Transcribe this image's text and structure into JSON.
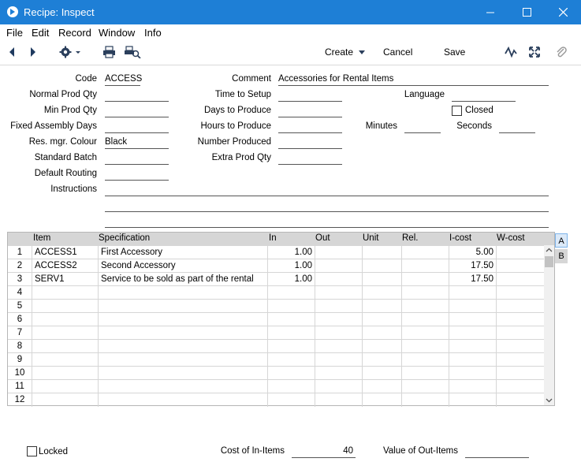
{
  "window": {
    "title": "Recipe: Inspect"
  },
  "menu": [
    "File",
    "Edit",
    "Record",
    "Window",
    "Info"
  ],
  "toolbar": {
    "create_label": "Create",
    "cancel_label": "Cancel",
    "save_label": "Save"
  },
  "header": {
    "code_label": "Code",
    "code_value": "ACCESS",
    "comment_label": "Comment",
    "comment_value": "Accessories for Rental Items",
    "normal_prod_qty_label": "Normal Prod Qty",
    "normal_prod_qty_value": "",
    "time_to_setup_label": "Time to Setup",
    "time_to_setup_value": "",
    "language_label": "Language",
    "language_value": "",
    "min_prod_qty_label": "Min Prod Qty",
    "min_prod_qty_value": "",
    "days_to_produce_label": "Days to Produce",
    "days_to_produce_value": "",
    "closed_label": "Closed",
    "closed_checked": false,
    "fixed_assembly_days_label": "Fixed Assembly Days",
    "fixed_assembly_days_value": "",
    "hours_to_produce_label": "Hours to Produce",
    "hours_to_produce_value": "",
    "minutes_label": "Minutes",
    "minutes_value": "",
    "seconds_label": "Seconds",
    "seconds_value": "",
    "res_mgr_colour_label": "Res. mgr. Colour",
    "res_mgr_colour_value": "Black",
    "number_produced_label": "Number Produced",
    "number_produced_value": "",
    "standard_batch_label": "Standard Batch",
    "standard_batch_value": "",
    "extra_prod_qty_label": "Extra Prod Qty",
    "extra_prod_qty_value": "",
    "default_routing_label": "Default Routing",
    "default_routing_value": "",
    "instructions_label": "Instructions",
    "instructions_value": ""
  },
  "grid": {
    "columns": [
      "Item",
      "Specification",
      "In",
      "Out",
      "Unit",
      "Rel.",
      "I-cost",
      "W-cost"
    ],
    "rows": [
      {
        "n": "1",
        "item": "ACCESS1",
        "spec": "First Accessory",
        "in": "1.00",
        "out": "",
        "unit": "",
        "rel": "",
        "icost": "5.00",
        "wcost": ""
      },
      {
        "n": "2",
        "item": "ACCESS2",
        "spec": "Second Accessory",
        "in": "1.00",
        "out": "",
        "unit": "",
        "rel": "",
        "icost": "17.50",
        "wcost": ""
      },
      {
        "n": "3",
        "item": "SERV1",
        "spec": "Service to be sold as part of the rental",
        "in": "1.00",
        "out": "",
        "unit": "",
        "rel": "",
        "icost": "17.50",
        "wcost": ""
      },
      {
        "n": "4",
        "item": "",
        "spec": "",
        "in": "",
        "out": "",
        "unit": "",
        "rel": "",
        "icost": "",
        "wcost": ""
      },
      {
        "n": "5",
        "item": "",
        "spec": "",
        "in": "",
        "out": "",
        "unit": "",
        "rel": "",
        "icost": "",
        "wcost": ""
      },
      {
        "n": "6",
        "item": "",
        "spec": "",
        "in": "",
        "out": "",
        "unit": "",
        "rel": "",
        "icost": "",
        "wcost": ""
      },
      {
        "n": "7",
        "item": "",
        "spec": "",
        "in": "",
        "out": "",
        "unit": "",
        "rel": "",
        "icost": "",
        "wcost": ""
      },
      {
        "n": "8",
        "item": "",
        "spec": "",
        "in": "",
        "out": "",
        "unit": "",
        "rel": "",
        "icost": "",
        "wcost": ""
      },
      {
        "n": "9",
        "item": "",
        "spec": "",
        "in": "",
        "out": "",
        "unit": "",
        "rel": "",
        "icost": "",
        "wcost": ""
      },
      {
        "n": "10",
        "item": "",
        "spec": "",
        "in": "",
        "out": "",
        "unit": "",
        "rel": "",
        "icost": "",
        "wcost": ""
      },
      {
        "n": "11",
        "item": "",
        "spec": "",
        "in": "",
        "out": "",
        "unit": "",
        "rel": "",
        "icost": "",
        "wcost": ""
      },
      {
        "n": "12",
        "item": "",
        "spec": "",
        "in": "",
        "out": "",
        "unit": "",
        "rel": "",
        "icost": "",
        "wcost": ""
      }
    ],
    "tabs": [
      "A",
      "B"
    ],
    "active_tab": "A"
  },
  "footer": {
    "locked_label": "Locked",
    "locked_checked": false,
    "cost_in_items_label": "Cost of In-Items",
    "cost_in_items_value": "40",
    "value_out_items_label": "Value of Out-Items",
    "value_out_items_value": ""
  },
  "colors": {
    "titlebar": "#1e7fd6",
    "grid_header": "#d6d6d6",
    "active_tab": "#dbe9f8"
  },
  "icons": [
    "app-icon",
    "minimize-icon",
    "maximize-icon",
    "close-icon",
    "prev-record-icon",
    "next-record-icon",
    "gear-icon",
    "print-icon",
    "print-preview-icon",
    "activity-icon",
    "fullscreen-icon",
    "attachment-icon",
    "scroll-up-icon",
    "scroll-down-icon"
  ]
}
